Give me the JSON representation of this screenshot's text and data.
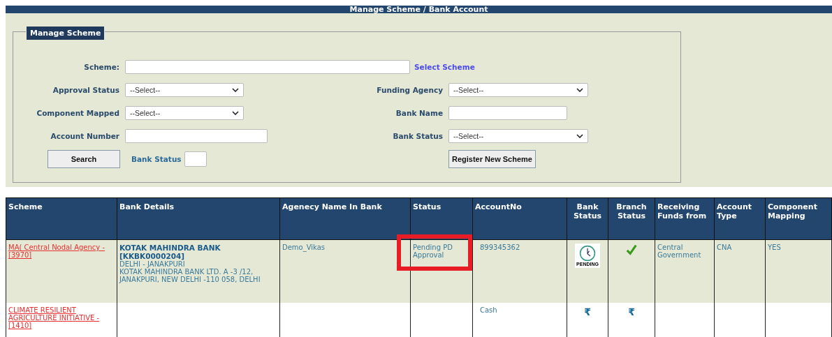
{
  "header": {
    "title": "Manage Scheme / Bank Account"
  },
  "form": {
    "legend": "Manage Scheme",
    "scheme": {
      "label": "Scheme:",
      "link": "Select Scheme"
    },
    "left": [
      {
        "label": "Approval Status",
        "kind": "select",
        "value": "--Select--"
      },
      {
        "label": "Component Mapped",
        "kind": "select",
        "value": "--Select--"
      },
      {
        "label": "Account Number",
        "kind": "text"
      }
    ],
    "right": [
      {
        "label": "Funding Agency",
        "kind": "select",
        "value": "--Select--"
      },
      {
        "label": "Bank Name",
        "kind": "text"
      },
      {
        "label": "Bank Status",
        "kind": "select",
        "value": "--Select--"
      }
    ],
    "search_button": "Search",
    "bank_status_label": "Bank Status",
    "register_button": "Register New Scheme"
  },
  "table": {
    "columns": [
      "Scheme",
      "Bank Details",
      "Agenecy Name In Bank",
      "Status",
      "AccountNo",
      "Bank Status",
      "Branch Status",
      "Receiving Funds from",
      "Account Type",
      "Component Mapping"
    ],
    "rows": [
      {
        "scheme": "MA( Central Nodal Agency - [3970]",
        "bank_name": "KOTAK MAHINDRA BANK [KKBK0000204]",
        "bank_address": "DELHI - JANAKPURI\nKOTAK MAHINDRA BANK LTD.   A -3 /12, JANAKPURI, NEW DELHI -110 058, DELHI",
        "agency": "Demo_Vikas",
        "status": "Pending PD Approval",
        "status_highlighted": true,
        "account_no": "899345362",
        "bank_status": {
          "kind": "pending",
          "label": "PENDING"
        },
        "branch_status": {
          "kind": "check"
        },
        "receiving": "Central Government",
        "account_type": "CNA",
        "mapping": "YES"
      },
      {
        "scheme": "CLIMATE RESILIENT AGRICULTURE INITIATIVE - [1410]",
        "account_no": "Cash",
        "bank_status": {
          "kind": "rupee",
          "label": "₹"
        },
        "branch_status": {
          "kind": "rupee",
          "label": "₹"
        },
        "status_highlighted": false
      }
    ]
  }
}
